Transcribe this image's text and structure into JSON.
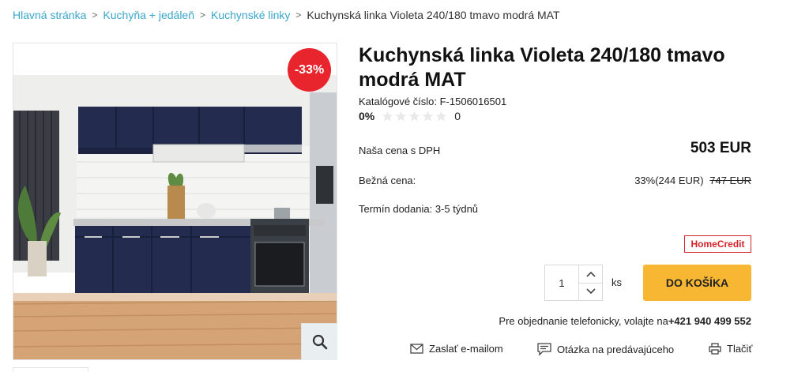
{
  "breadcrumb": {
    "items": [
      "Hlavná stránka",
      "Kuchyňa + jedáleň",
      "Kuchynské linky"
    ],
    "current": "Kuchynská linka Violeta 240/180 tmavo modrá MAT"
  },
  "product": {
    "title": "Kuchynská linka Violeta 240/180 tmavo modrá MAT",
    "discount_badge": "-33%",
    "catalog_number": "Katalógové číslo: F-1506016501",
    "rating_percent": "0%",
    "rating_count": "0",
    "rating_stars": 0,
    "our_price_label": "Naša cena s DPH",
    "our_price": "503 EUR",
    "normal_price_label": "Bežná cena:",
    "saving": "33%(244 EUR)",
    "old_price": "747 EUR",
    "delivery": "Termín dodania: 3-5 týdnů",
    "homecredit": "HomeCredit"
  },
  "cart": {
    "quantity": "1",
    "unit": "ks",
    "button_label": "DO KOŠÍKA"
  },
  "phone": {
    "text": "Pre objednanie telefonicky, volajte na",
    "number": "+421 940 499 552"
  },
  "actions": {
    "email": "Zaslať e-mailom",
    "question": "Otázka na predávajúceho",
    "print": "Tlačiť"
  },
  "colors": {
    "link": "#3aa6c9",
    "discount": "#e8252c",
    "cart_button": "#f7b733",
    "homecredit": "#d3232b",
    "cabinet": "#232b4e"
  },
  "icons": {
    "zoom": "search-icon",
    "email": "envelope-icon",
    "question": "chat-icon",
    "print": "printer-icon",
    "up": "chevron-up-icon",
    "down": "chevron-down-icon"
  }
}
